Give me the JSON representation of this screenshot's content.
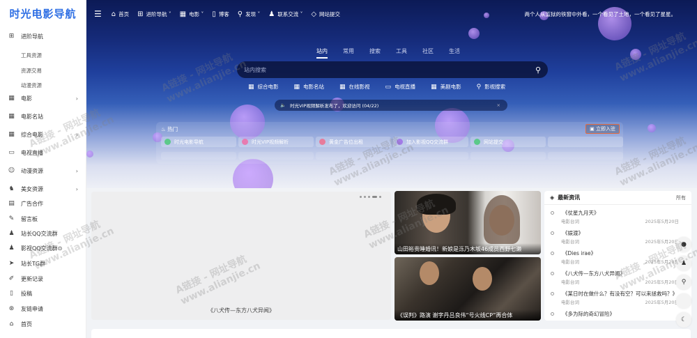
{
  "sidebar": {
    "logo": "时光电影导航",
    "items": [
      {
        "label": "进阶导航",
        "icon": "grid-icon",
        "expandable": false
      },
      {
        "label": "电影",
        "icon": "film-icon",
        "expandable": true
      },
      {
        "label": "电影名站",
        "icon": "film-icon",
        "expandable": false
      },
      {
        "label": "综合电影",
        "icon": "film-icon",
        "expandable": true
      },
      {
        "label": "电视直播",
        "icon": "tv-icon",
        "expandable": false
      },
      {
        "label": "动漫资源",
        "icon": "cat-icon",
        "expandable": true
      },
      {
        "label": "美女资源",
        "icon": "person-icon",
        "expandable": true
      },
      {
        "label": "广告合作",
        "icon": "ad-icon",
        "expandable": false
      },
      {
        "label": "留言板",
        "icon": "message-icon",
        "expandable": false
      },
      {
        "label": "站长QQ交流群",
        "icon": "qq-icon",
        "expandable": false
      },
      {
        "label": "影视QQ交流群⊙",
        "icon": "qq-icon",
        "expandable": false
      },
      {
        "label": "站长TG群",
        "icon": "telegram-icon",
        "expandable": false
      },
      {
        "label": "更新记录",
        "icon": "edit-icon",
        "expandable": false
      },
      {
        "label": "投稿",
        "icon": "doc-icon",
        "expandable": false
      },
      {
        "label": "友链申请",
        "icon": "link-icon",
        "expandable": false
      },
      {
        "label": "首页",
        "icon": "home-icon",
        "expandable": false
      }
    ],
    "subitems": [
      "工具资源",
      "资源交易",
      "动漫资源"
    ]
  },
  "topbar": {
    "menu_icon": "menu-icon",
    "items": [
      {
        "label": "首页",
        "icon": "home-icon"
      },
      {
        "label": "进阶导航 ˅",
        "icon": "grid-icon"
      },
      {
        "label": "电影 ˅",
        "icon": "film-icon"
      },
      {
        "label": "博客",
        "icon": "doc-icon"
      },
      {
        "label": "发现 ˅",
        "icon": "search-icon"
      },
      {
        "label": "联系交流 ˅",
        "icon": "qq-icon"
      },
      {
        "label": "网站提交",
        "icon": "diamond-icon"
      }
    ],
    "tagline": "两个人从监狱的铁窗中外看，一个看见了土地，一个看见了星星。"
  },
  "search": {
    "tabs": [
      "站内",
      "常用",
      "搜索",
      "工具",
      "社区",
      "生活"
    ],
    "active_tab": 0,
    "placeholder": "站内搜索",
    "engines": [
      {
        "label": "综合电影",
        "icon": "film-icon"
      },
      {
        "label": "电影名站",
        "icon": "film-icon"
      },
      {
        "label": "在线影视",
        "icon": "film-icon"
      },
      {
        "label": "电视直播",
        "icon": "tv-icon"
      },
      {
        "label": "美剧电影",
        "icon": "film-icon"
      },
      {
        "label": "影视搜索",
        "icon": "search-icon"
      }
    ]
  },
  "notice": {
    "text": "时光VIP视频解析发布了，欢迎访问 (04/22)"
  },
  "hot": {
    "title": "热门",
    "join": "立即入驻",
    "items": [
      {
        "label": "时光电影导航",
        "color": "#5cc98a"
      },
      {
        "label": "时光VIP视频解析",
        "color": "#e77bb0"
      },
      {
        "label": "黄金广告位出租",
        "color": "#e77b9b"
      },
      {
        "label": "加入影视QQ交流群",
        "color": "#a27be7"
      },
      {
        "label": "网站提交",
        "color": "#5cc98a"
      }
    ]
  },
  "carousel": {
    "caption": "《八犬传—东方八犬异闻》"
  },
  "news_cards": [
    {
      "caption": "山田裕贵睡婚讯！新娘是泺乃木坂46成员西野七濑"
    },
    {
      "caption": "《误判》路演 谢字丹吕良伟“号火线CP”再合体"
    }
  ],
  "latest": {
    "title": "最新资讯",
    "all_label": "所有",
    "items": [
      {
        "title": "《仗星九月天》",
        "cat": "电影台词",
        "date": "2025年5月20日"
      },
      {
        "title": "《娱渡》",
        "cat": "电影台词",
        "date": "2025年5月20日"
      },
      {
        "title": "《Dies irae》",
        "cat": "电影台词",
        "date": "2025年5月20日"
      },
      {
        "title": "《八犬传—东方八犬异闻》",
        "cat": "电影台词",
        "date": "2025年5月20日"
      },
      {
        "title": "《某日时在做什么？有没有空？可以来拯救吗？》",
        "cat": "电影台词",
        "date": "2025年5月20日"
      },
      {
        "title": "《多为际的奇幻冒险》",
        "cat": "",
        "date": ""
      }
    ]
  },
  "watermark": "A链接 - 网址导航\nwww.alianjie.cn"
}
